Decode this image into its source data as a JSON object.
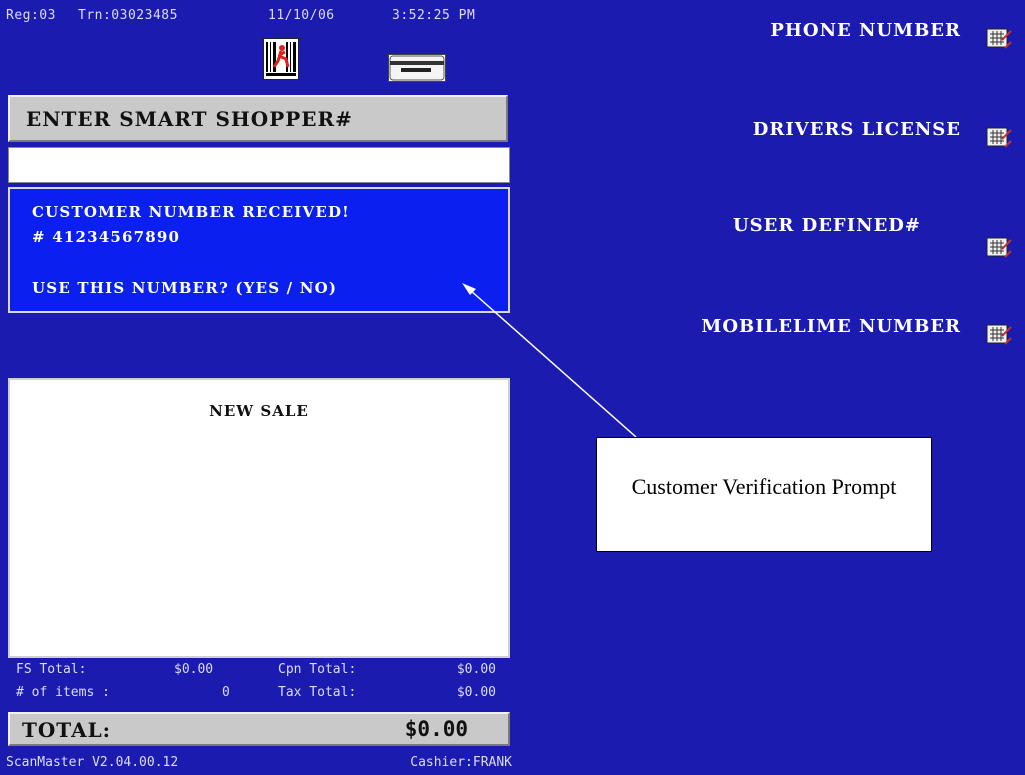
{
  "status_bar": {
    "register": "Reg:03",
    "transaction": "Trn:03023485",
    "date": "11/10/06",
    "time": "3:52:25 PM"
  },
  "prompt": {
    "title": "ENTER SMART SHOPPER#",
    "input_value": ""
  },
  "message": {
    "line1": "CUSTOMER NUMBER RECEIVED!",
    "line2": "# 41234567890",
    "line3": "USE THIS NUMBER? (YES / NO)"
  },
  "receipt": {
    "title": "NEW SALE"
  },
  "totals": {
    "fs_total_label": "FS Total:",
    "fs_total_value": "$0.00",
    "cpn_total_label": "Cpn Total:",
    "cpn_total_value": "$0.00",
    "items_label": "# of items :",
    "items_value": "0",
    "tax_total_label": "Tax Total:",
    "tax_total_value": "$0.00",
    "grand_label": "TOTAL:",
    "grand_value": "$0.00"
  },
  "footer": {
    "version": "ScanMaster V2.04.00.12",
    "cashier": "Cashier:FRANK"
  },
  "menu": {
    "items": [
      {
        "label": "PHONE NUMBER",
        "icon": "keypad-entry-icon"
      },
      {
        "label": "DRIVERS LICENSE",
        "icon": "keypad-entry-icon"
      },
      {
        "label": "USER DEFINED#",
        "icon": "keypad-entry-icon"
      },
      {
        "label": "MOBILELIME NUMBER",
        "icon": "keypad-entry-icon"
      }
    ]
  },
  "callout": {
    "text": "Customer Verification Prompt"
  },
  "colors": {
    "background": "#1b1bb0",
    "message_box": "#0a1ff0",
    "panel_gray": "#c9c9c9"
  }
}
